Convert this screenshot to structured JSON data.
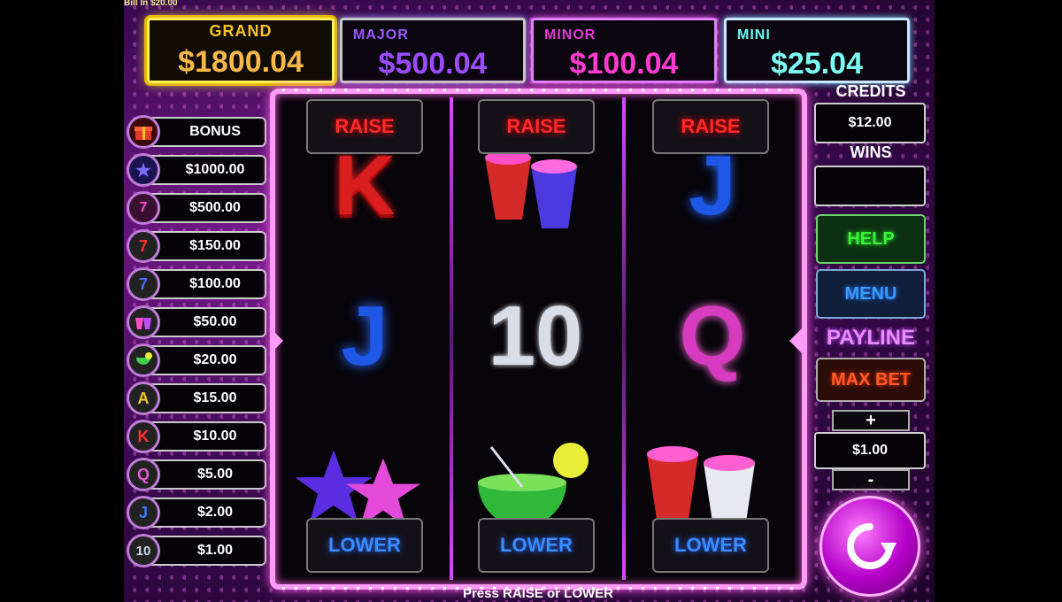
{
  "bill_in": "Bill In $20.00",
  "jackpots": {
    "grand": {
      "label": "GRAND",
      "value": "$1800.04"
    },
    "major": {
      "label": "MAJOR",
      "value": "$500.04"
    },
    "minor": {
      "label": "MINOR",
      "value": "$100.04"
    },
    "mini": {
      "label": "MINI",
      "value": "$25.04"
    }
  },
  "paytable": [
    {
      "icon": "gift-box-icon",
      "value": "BONUS"
    },
    {
      "icon": "stars-icon",
      "value": "$1000.00"
    },
    {
      "icon": "super-seven-icon",
      "value": "$500.00"
    },
    {
      "icon": "red-seven-icon",
      "value": "$150.00"
    },
    {
      "icon": "blue-seven-icon",
      "value": "$100.00"
    },
    {
      "icon": "cups-icon",
      "value": "$50.00"
    },
    {
      "icon": "cocktail-icon",
      "value": "$20.00"
    },
    {
      "icon": "letter-a-icon",
      "value": "$15.00",
      "glyph": "A"
    },
    {
      "icon": "letter-k-icon",
      "value": "$10.00",
      "glyph": "K"
    },
    {
      "icon": "letter-q-icon",
      "value": "$5.00",
      "glyph": "Q"
    },
    {
      "icon": "letter-j-icon",
      "value": "$2.00",
      "glyph": "J"
    },
    {
      "icon": "number-10-icon",
      "value": "$1.00",
      "glyph": "10"
    }
  ],
  "reels": {
    "raise_label": "RAISE",
    "lower_label": "LOWER",
    "symbols": {
      "r1_top": "K",
      "r2_top": "cups",
      "r3_top": "J",
      "r1_mid": "J",
      "r2_mid": "10",
      "r3_mid": "Q",
      "r1_bot": "star-balloons",
      "r2_bot": "cocktail",
      "r3_bot": "cups"
    }
  },
  "panel": {
    "credits_label": "CREDITS",
    "credits_value": "$12.00",
    "wins_label": "WINS",
    "wins_value": "",
    "help_label": "HELP",
    "menu_label": "MENU",
    "payline_label": "PAYLINE",
    "maxbet_label": "MAX BET",
    "plus_label": "+",
    "bet_value": "$1.00",
    "minus_label": "-"
  },
  "status_text": "Press RAISE or LOWER"
}
